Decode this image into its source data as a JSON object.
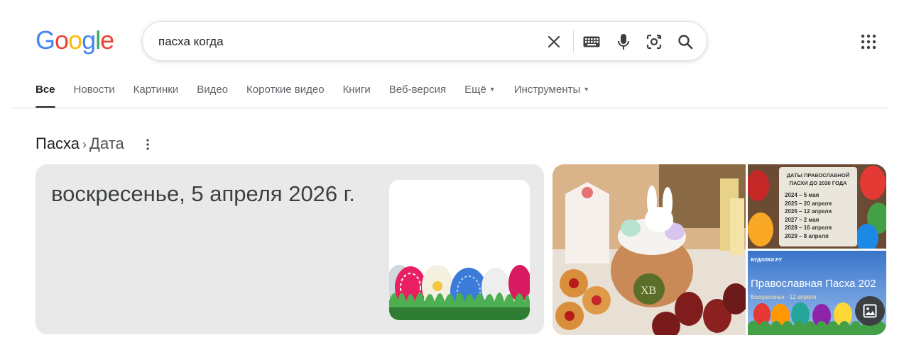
{
  "logo": {
    "letters": [
      "G",
      "o",
      "o",
      "g",
      "l",
      "e"
    ],
    "colors": [
      "#4285F4",
      "#EA4335",
      "#FBBC05",
      "#4285F4",
      "#34A853",
      "#EA4335"
    ]
  },
  "search": {
    "query": "пасха когда"
  },
  "icons": {
    "clear": "close-icon",
    "keyboard": "keyboard-icon",
    "mic": "microphone-icon",
    "lens": "camera-lens-icon",
    "search": "search-icon",
    "apps": "apps-grid-icon",
    "more": "more-vert-icon",
    "gallery": "image-gallery-icon"
  },
  "tabs": [
    {
      "label": "Все",
      "active": true
    },
    {
      "label": "Новости"
    },
    {
      "label": "Картинки"
    },
    {
      "label": "Видео"
    },
    {
      "label": "Короткие видео"
    },
    {
      "label": "Книги"
    },
    {
      "label": "Веб-версия"
    },
    {
      "label": "Ещё",
      "dropdown": true
    },
    {
      "label": "Инструменты",
      "dropdown": true
    }
  ],
  "breadcrumb": {
    "parent": "Пасха",
    "separator": "›",
    "current": "Дата"
  },
  "answer": {
    "date": "воскресенье, 5 апреля 2026 г."
  },
  "images": {
    "main_label": "ХВ",
    "dates_card": {
      "title": "ДАТЫ ПРАВОСЛАВНОЙ ПАСХИ ДО 2030 ГОДА",
      "items": [
        "2024 – 5 мая",
        "2025 – 20 апреля",
        "2026 – 12 апреля",
        "2027 – 2 мая",
        "2028 – 16 апреля",
        "2029 – 8 апреля"
      ]
    },
    "banner": {
      "site": "БУДИЛКИ.РУ",
      "title": "Православная Пасха 202",
      "subtitle": "Воскресенье · 12 апреля"
    }
  }
}
